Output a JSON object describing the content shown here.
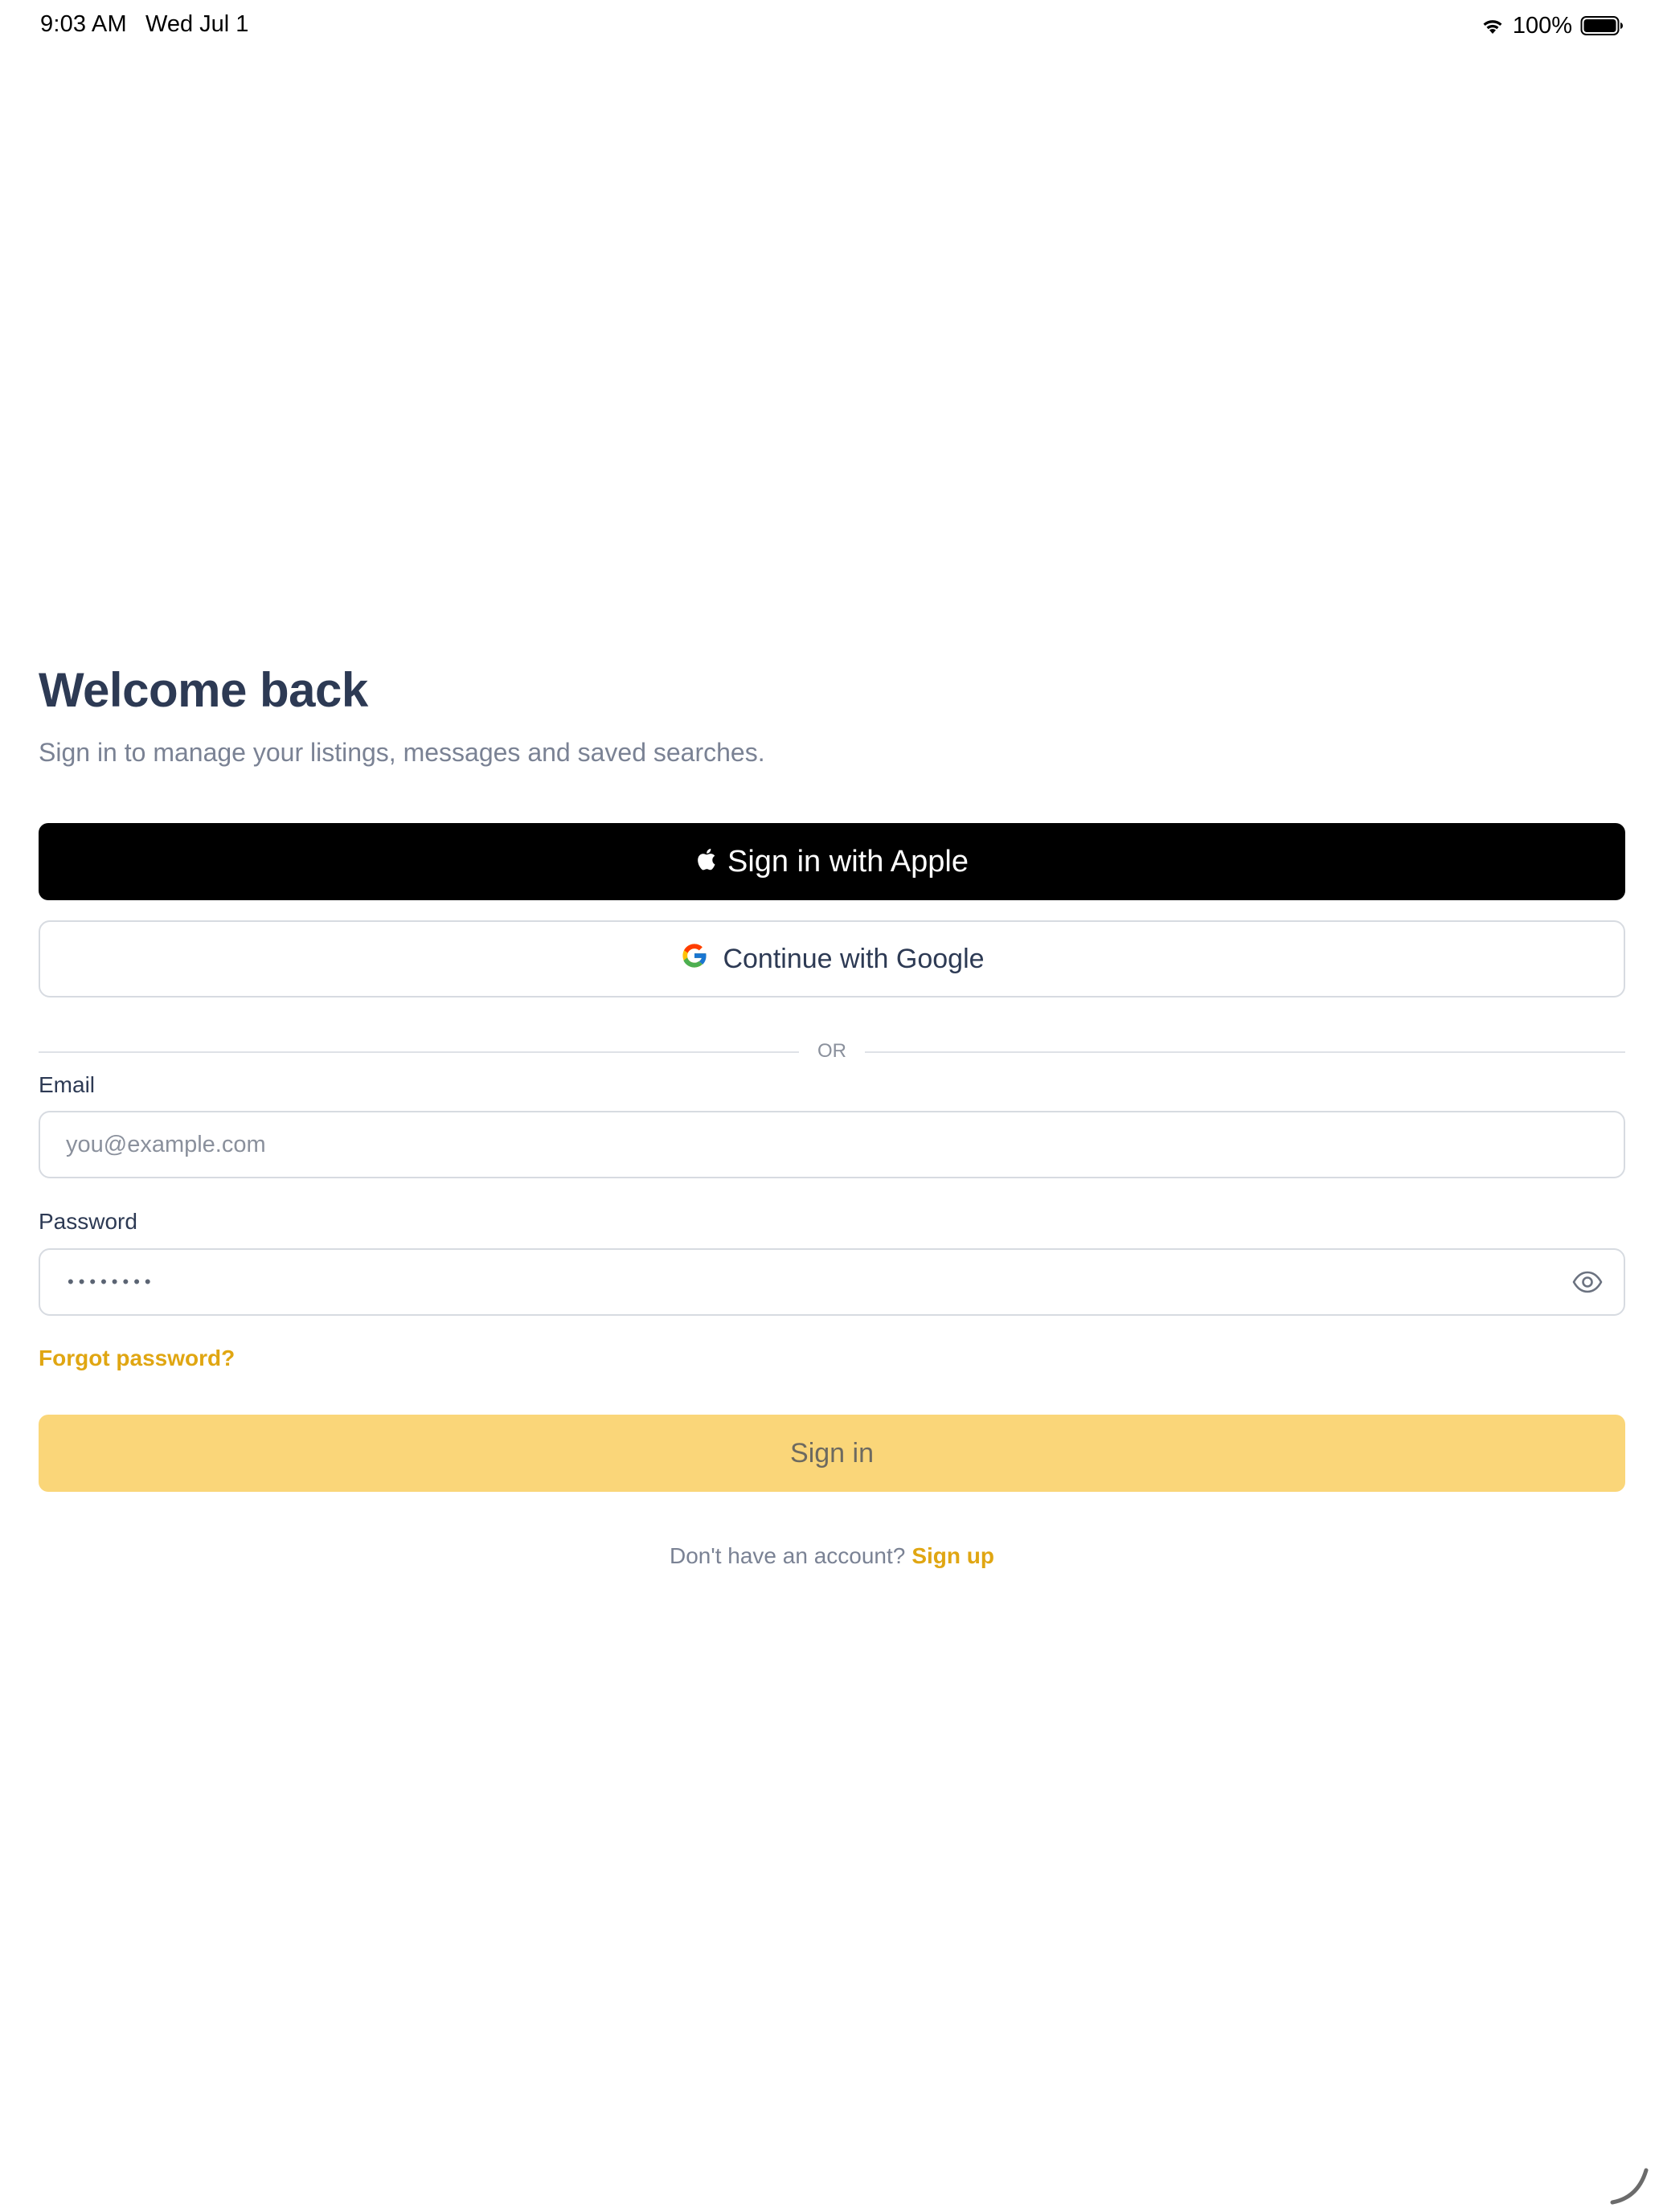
{
  "status_bar": {
    "time": "9:03 AM",
    "date": "Wed Jul 1",
    "battery_percent": "100%",
    "wifi_icon": "wifi-icon",
    "battery_icon": "battery-full-icon"
  },
  "header": {
    "title": "Welcome back",
    "subtitle": "Sign in to manage your listings, messages and saved searches."
  },
  "social": {
    "apple_label": "Sign in with Apple",
    "apple_icon": "apple-logo-icon",
    "google_label": "Continue with Google",
    "google_icon": "google-logo-icon"
  },
  "divider": {
    "text": "OR"
  },
  "form": {
    "email_label": "Email",
    "email_placeholder": "you@example.com",
    "email_value": "",
    "password_label": "Password",
    "password_value_masked": "••••••••",
    "password_toggle_icon": "eye-icon",
    "forgot_label": "Forgot password?",
    "submit_label": "Sign in"
  },
  "footer": {
    "prompt": "Don't have an account?",
    "signup_label": "Sign up"
  },
  "colors": {
    "accent": "#e0a612",
    "submit_bg": "#fad679",
    "title": "#2d3a54",
    "muted": "#7a8294"
  }
}
